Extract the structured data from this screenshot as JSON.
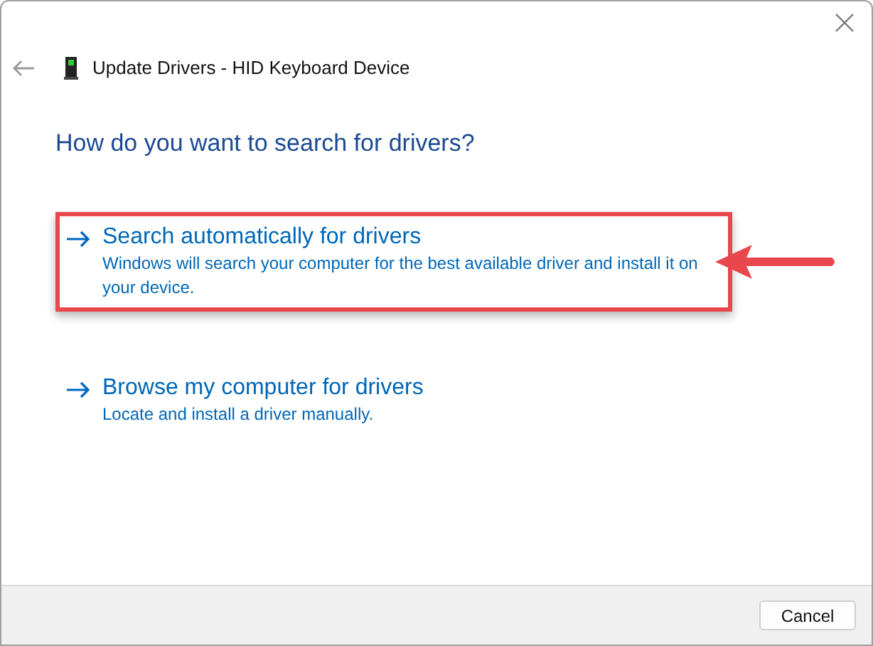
{
  "window": {
    "title": "Update Drivers - HID Keyboard Device"
  },
  "heading": "How do you want to search for drivers?",
  "options": [
    {
      "title": "Search automatically for drivers",
      "description": "Windows will search your computer for the best available driver and install it on your device.",
      "highlighted": true
    },
    {
      "title": "Browse my computer for drivers",
      "description": "Locate and install a driver manually.",
      "highlighted": false
    }
  ],
  "buttons": [
    "Cancel"
  ]
}
